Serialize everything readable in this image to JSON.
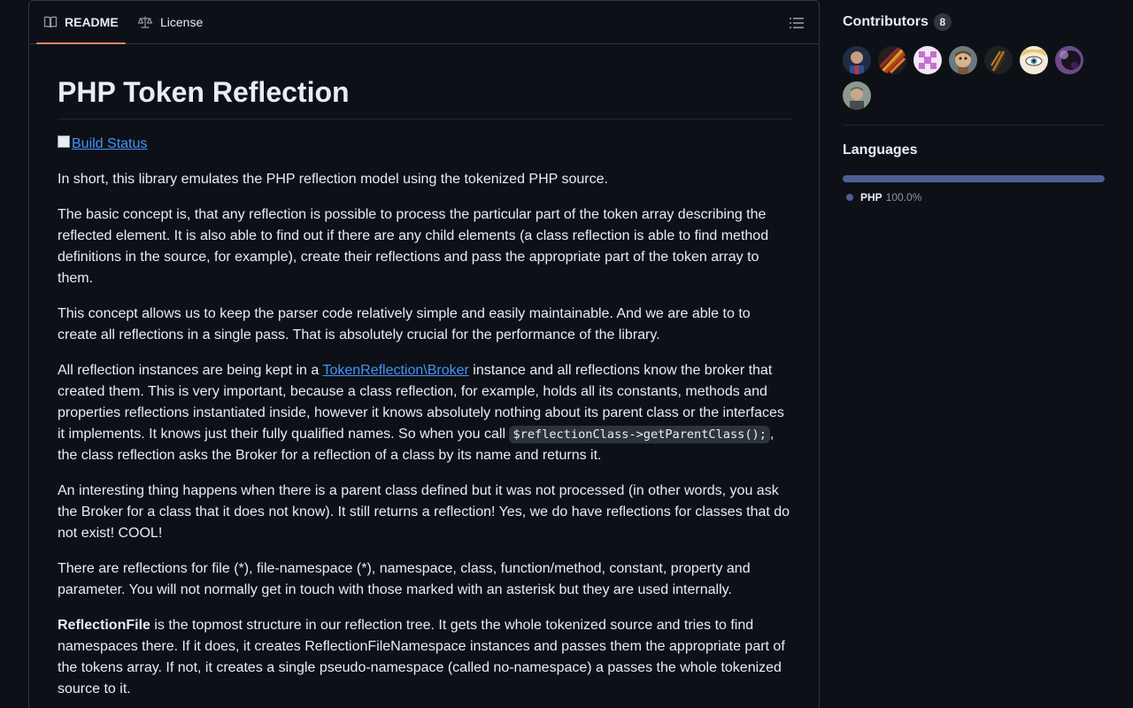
{
  "tabs": {
    "readme": "README",
    "license": "License"
  },
  "readme": {
    "title": "PHP Token Reflection",
    "badge_alt": "Build Status",
    "p1": "In short, this library emulates the PHP reflection model using the tokenized PHP source.",
    "p2": "The basic concept is, that any reflection is possible to process the particular part of the token array describing the reflected element. It is also able to find out if there are any child elements (a class reflection is able to find method definitions in the source, for example), create their reflections and pass the appropriate part of the token array to them.",
    "p3": "This concept allows us to keep the parser code relatively simple and easily maintainable. And we are able to to create all reflections in a single pass. That is absolutely crucial for the performance of the library.",
    "p4_a": "All reflection instances are being kept in a ",
    "p4_link": "TokenReflection\\Broker",
    "p4_b": " instance and all reflections know the broker that created them. This is very important, because a class reflection, for example, holds all its constants, methods and properties reflections instantiated inside, however it knows absolutely nothing about its parent class or the interfaces it implements. It knows just their fully qualified names. So when you call ",
    "p4_code": "$reflectionClass->getParentClass();",
    "p4_c": ", the class reflection asks the Broker for a reflection of a class by its name and returns it.",
    "p5": "An interesting thing happens when there is a parent class defined but it was not processed (in other words, you ask the Broker for a class that it does not know). It still returns a reflection! Yes, we do have reflections for classes that do not exist! COOL!",
    "p6": "There are reflections for file (*), file-namespace (*), namespace, class, function/method, constant, property and parameter. You will not normally get in touch with those marked with an asterisk but they are used internally.",
    "p7_strong": "ReflectionFile",
    "p7_rest": " is the topmost structure in our reflection tree. It gets the whole tokenized source and tries to find namespaces there. If it does, it creates ReflectionFileNamespace instances and passes them the appropriate part of the tokens array. If not, it creates a single pseudo-namespace (called no-namespace) a passes the whole tokenized source to it."
  },
  "sidebar": {
    "contributors_title": "Contributors",
    "contributors_count": "8",
    "languages_title": "Languages",
    "languages": [
      {
        "name": "PHP",
        "percent": "100.0%",
        "fraction": 1.0,
        "color": "#4f5d95"
      }
    ]
  },
  "colors": {
    "background": "#0d1117",
    "border": "#30363d",
    "link": "#4493f8",
    "tab_accent": "#f78166",
    "php": "#4f5d95"
  }
}
